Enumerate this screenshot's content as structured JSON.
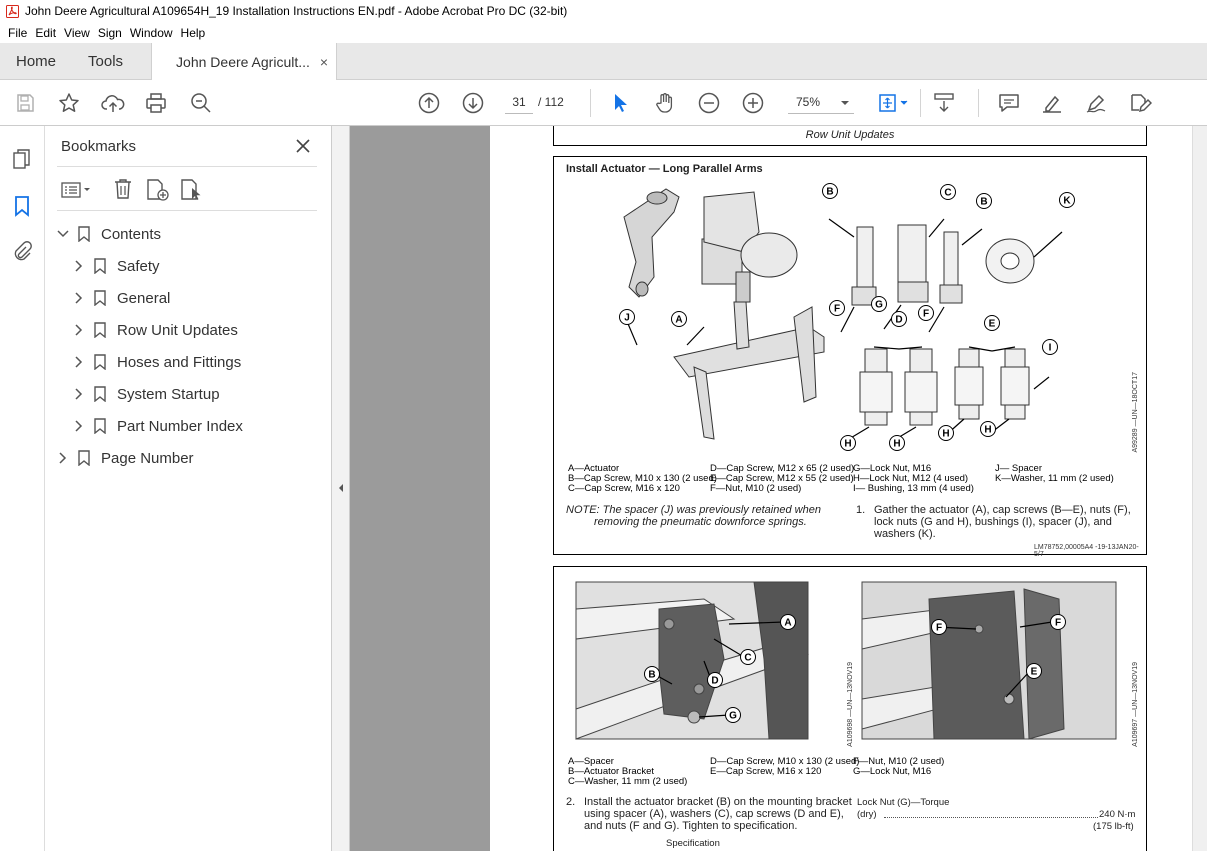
{
  "window": {
    "title": "John Deere Agricultural A109654H_19 Installation Instructions EN.pdf - Adobe Acrobat Pro DC (32-bit)"
  },
  "menu": [
    "File",
    "Edit",
    "View",
    "Sign",
    "Window",
    "Help"
  ],
  "tabs": {
    "home": "Home",
    "tools": "Tools",
    "document": "John Deere Agricult...",
    "close": "×"
  },
  "toolbar": {
    "current_page": "31",
    "total_pages": "/ 112",
    "zoom": "75%"
  },
  "bookmarks": {
    "header": "Bookmarks",
    "items": [
      {
        "label": "Contents",
        "level": 0,
        "expanded": true
      },
      {
        "label": "Safety",
        "level": 1,
        "expanded": false
      },
      {
        "label": "General",
        "level": 1,
        "expanded": false
      },
      {
        "label": "Row Unit Updates",
        "level": 1,
        "expanded": false
      },
      {
        "label": "Hoses and Fittings",
        "level": 1,
        "expanded": false
      },
      {
        "label": "System Startup",
        "level": 1,
        "expanded": false
      },
      {
        "label": "Part Number Index",
        "level": 1,
        "expanded": false
      },
      {
        "label": "Page Number",
        "level": 0,
        "expanded": false
      }
    ]
  },
  "document": {
    "running_header": "Row Unit Updates",
    "section1": {
      "title": "Install Actuator — Long Parallel Arms",
      "legend": {
        "col1": [
          "A—Actuator",
          "B—Cap Screw, M10 x 130 (2 used)",
          "C—Cap Screw, M16 x 120"
        ],
        "col2": [
          "D—Cap Screw, M12 x 65 (2 used)",
          "E—Cap Screw, M12 x 55 (2 used)",
          "F—Nut, M10 (2 used)"
        ],
        "col3": [
          "G—Lock Nut, M16",
          "H—Lock Nut, M12 (4 used)",
          "I— Bushing, 13 mm (4 used)"
        ],
        "col4": [
          "J— Spacer",
          "K—Washer, 11 mm (2 used)"
        ]
      },
      "note_line1": "NOTE: The spacer (J) was previously retained when",
      "note_line2": "removing the pneumatic downforce springs.",
      "step_num": "1.",
      "step_line1": "Gather the actuator (A), cap screws (B—E), nuts (F),",
      "step_line2": "lock nuts (G and H), bushings (I), spacer (J), and",
      "step_line3": "washers (K).",
      "figure_id": "A99289 —UN—18OCT17",
      "footer_id": "LM78752,00005A4 -19-13JAN20-5/7"
    },
    "section2": {
      "legend": {
        "col1": [
          "A—Spacer",
          "B—Actuator Bracket",
          "C—Washer, 11 mm (2 used)"
        ],
        "col2": [
          "D—Cap Screw, M10 x 130 (2 used)",
          "E—Cap Screw, M16 x 120"
        ],
        "col3": [
          "F—Nut, M10 (2 used)",
          "G—Lock Nut, M16"
        ]
      },
      "step_num": "2.",
      "step_line1": "Install the actuator bracket (B) on the mounting bracket",
      "step_line2": "using spacer (A), washers (C), cap screws (D and E),",
      "step_line3": "and nuts (F and G). Tighten to specification.",
      "spec_heading": "Specification",
      "spec_label": "Lock Nut (G)—Torque",
      "spec_sub": "(dry)",
      "spec_value": "240 N·m",
      "spec_value2": "(175 lb-ft)",
      "figure_id_left": "A109698 —UN—13NOV19",
      "figure_id_right": "A109697 —UN—13NOV19"
    },
    "labels": {
      "A": "A",
      "B": "B",
      "C": "C",
      "D": "D",
      "E": "E",
      "F": "F",
      "G": "G",
      "H": "H",
      "I": "I",
      "J": "J",
      "K": "K"
    }
  },
  "colors": {
    "accent": "#1473e6",
    "tab_bg": "#e8e8e8",
    "doc_bg": "#9b9b9b",
    "acrobat_red": "#d8291c"
  }
}
